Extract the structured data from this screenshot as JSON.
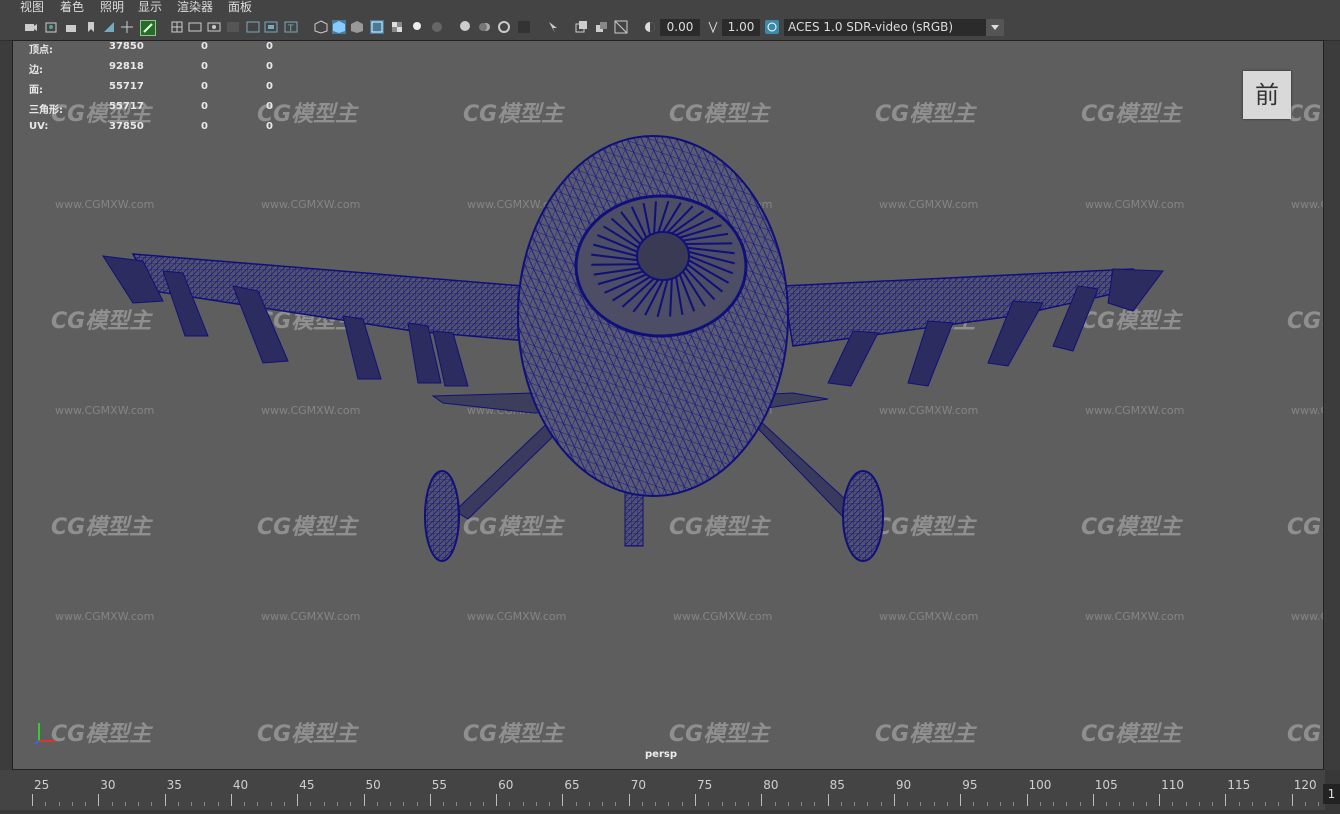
{
  "menu": [
    "视图",
    "着色",
    "照明",
    "显示",
    "渲染器",
    "面板"
  ],
  "toolbar": {
    "exposure_value": "0.00",
    "gamma_value": "1.00",
    "color_space": "ACES 1.0 SDR-video (sRGB)",
    "icons": [
      "select-camera-icon",
      "camera-attributes-icon",
      "bookmark-icon",
      "grid-icon",
      "film-gate-icon",
      "resolution-gate-icon",
      "wireframe-icon",
      "smooth-shade-icon",
      "textured-icon",
      "lights-icon",
      "shadows-icon",
      "isolate-icon",
      "xray-icon",
      "exposure-icon",
      "gamma-icon",
      "color-management-icon"
    ]
  },
  "stats": {
    "rows": [
      {
        "label": "顶点:",
        "v1": "37850",
        "v2": "0",
        "v3": "0"
      },
      {
        "label": "边:",
        "v1": "92818",
        "v2": "0",
        "v3": "0"
      },
      {
        "label": "面:",
        "v1": "55717",
        "v2": "0",
        "v3": "0"
      },
      {
        "label": "三角形:",
        "v1": "55717",
        "v2": "0",
        "v3": "0"
      },
      {
        "label": "UV:",
        "v1": "37850",
        "v2": "0",
        "v3": "0"
      }
    ]
  },
  "view_cube_label": "前",
  "camera_label": "persp",
  "watermark_logo": "CG模型主",
  "watermark_url": "www.CGMXW.com",
  "mesh_color": "#1a1a8c",
  "viewport_bg": "#5e5e5e",
  "timeline": {
    "labels": [
      "25",
      "30",
      "35",
      "40",
      "45",
      "50",
      "55",
      "60",
      "65",
      "70",
      "75",
      "80",
      "85",
      "90",
      "95",
      "100",
      "105",
      "110",
      "115",
      "120"
    ],
    "current_frame": "1"
  }
}
